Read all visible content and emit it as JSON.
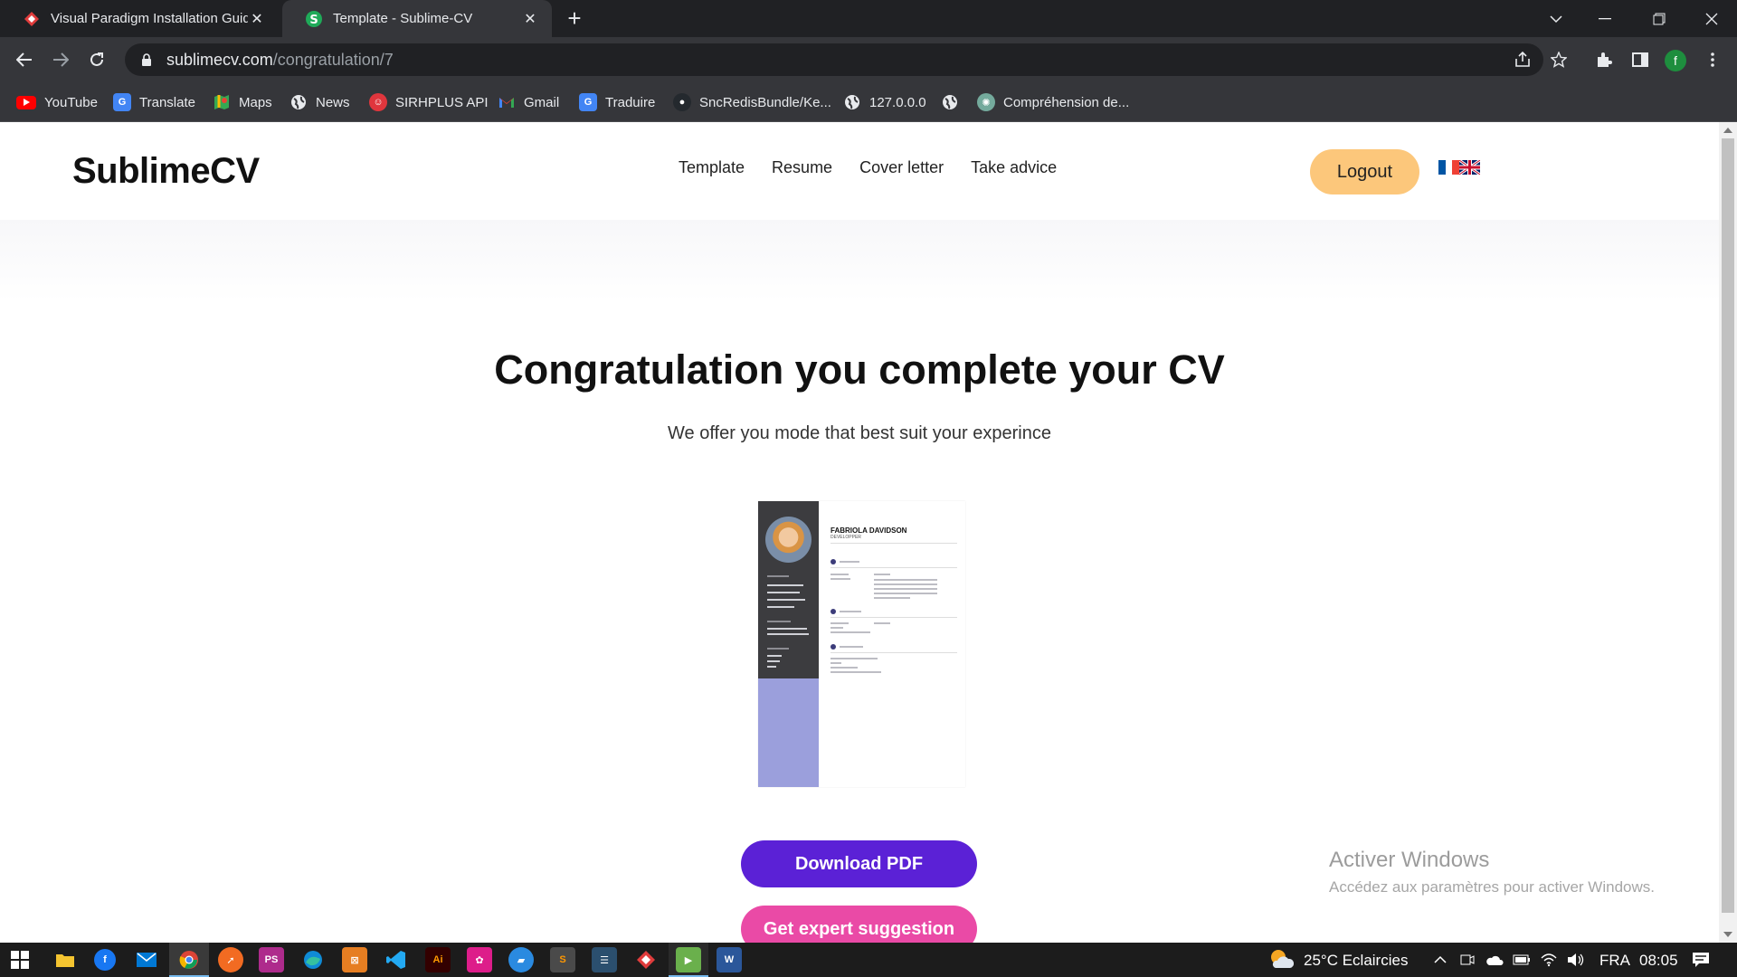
{
  "browser": {
    "tabs": [
      {
        "title": "Visual Paradigm Installation Guid",
        "icon": "visual-paradigm-icon",
        "active": false
      },
      {
        "title": "Template - Sublime-CV",
        "icon": "sublimecv-s-icon",
        "active": true
      }
    ],
    "url_host": "sublimecv.com",
    "url_path": "/congratulation/7",
    "profile_initial": "f",
    "bookmarks": [
      {
        "label": "YouTube",
        "icon": "youtube-icon"
      },
      {
        "label": "Translate",
        "icon": "google-translate-icon"
      },
      {
        "label": "Maps",
        "icon": "google-maps-icon"
      },
      {
        "label": "News",
        "icon": "globe-icon"
      },
      {
        "label": "SIRHPLUS API",
        "icon": "sirhplus-icon"
      },
      {
        "label": "Gmail",
        "icon": "gmail-icon"
      },
      {
        "label": "Traduire",
        "icon": "google-translate-icon"
      },
      {
        "label": "SncRedisBundle/Ke...",
        "icon": "github-icon"
      },
      {
        "label": "127.0.0.0",
        "icon": "globe-icon"
      },
      {
        "label": "",
        "icon": "globe-icon"
      },
      {
        "label": "Compréhension de...",
        "icon": "chatgpt-icon"
      }
    ]
  },
  "site": {
    "logo": "SublimeCV",
    "nav": [
      "Template",
      "Resume",
      "Cover letter",
      "Take advice"
    ],
    "logout_label": "Logout",
    "flags": [
      "french-flag-icon",
      "uk-flag-icon"
    ]
  },
  "main": {
    "headline": "Congratulation you complete your CV",
    "subline": "We offer you mode that best suit your experince",
    "cv_preview": {
      "name": "FABRIOLA DAVIDSON",
      "role": "DEVELOPPER"
    },
    "download_label": "Download PDF",
    "expert_label": "Get expert suggestion"
  },
  "watermark": {
    "title": "Activer Windows",
    "subtitle": "Accédez aux paramètres pour activer Windows."
  },
  "taskbar": {
    "weather": "25°C Eclaircies",
    "language": "FRA",
    "time": "08:05"
  },
  "colors": {
    "logout": "#fcc77b",
    "download": "#5b21d6",
    "expert": "#ea4aa6",
    "cv_sidebar": "#9b9fdc"
  }
}
